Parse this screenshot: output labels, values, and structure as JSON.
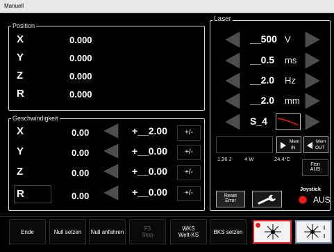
{
  "window": {
    "title": "Manuell"
  },
  "position": {
    "label": "Position",
    "rows": [
      {
        "axis": "X",
        "value": "0.000"
      },
      {
        "axis": "Y",
        "value": "0.000"
      },
      {
        "axis": "Z",
        "value": "0.000"
      },
      {
        "axis": "R",
        "value": "0.000"
      }
    ]
  },
  "speed": {
    "label": "Geschwindigkeit",
    "rows": [
      {
        "axis": "X",
        "value": "0.00",
        "setpoint": "+__2.00",
        "pm": "+/-"
      },
      {
        "axis": "Y",
        "value": "0.00",
        "setpoint": "+__0.00",
        "pm": "+/-"
      },
      {
        "axis": "Z",
        "value": "0.00",
        "setpoint": "+__0.00",
        "pm": "+/-"
      },
      {
        "axis": "R",
        "value": "0.00",
        "setpoint": "+__0.00",
        "pm": "+/-"
      }
    ]
  },
  "laser": {
    "label": "Laser",
    "params": [
      {
        "value": "__500",
        "unit": "V"
      },
      {
        "value": "__0.5",
        "unit": "ms"
      },
      {
        "value": "__2.0",
        "unit": "Hz"
      },
      {
        "value": "__2.0",
        "unit": "mm"
      }
    ],
    "shape": {
      "value": "S_4"
    },
    "mem_in": {
      "line1": "Mem",
      "line2": "IN"
    },
    "mem_out": {
      "line1": "Mem",
      "line2": "OUT"
    },
    "readouts": {
      "energy": "1,96 J",
      "power": "4 W",
      "temp": "24.4°C"
    },
    "fein": {
      "line1": "Fein",
      "line2": "AUS"
    },
    "reset": {
      "line1": "Reset",
      "line2": "Error"
    },
    "joystick": {
      "label": "Joystick",
      "state": "AUS",
      "led_color": "#ff1a1a"
    }
  },
  "bottom": {
    "buttons": [
      {
        "label": "Ende"
      },
      {
        "label": "Null setzen"
      },
      {
        "label": "Null anfahren"
      },
      {
        "line1": "F3",
        "line2": "Stop"
      },
      {
        "line1": "WKS",
        "line2": "Welt-KS"
      },
      {
        "label": "BKS setzen"
      }
    ]
  },
  "colors": {
    "accent_red": "#e82020",
    "arrow_gray": "#4d4d4d"
  }
}
